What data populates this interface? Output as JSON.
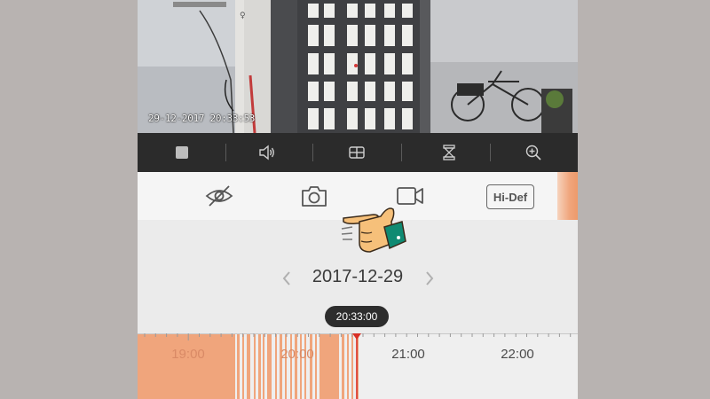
{
  "video": {
    "osd_timestamp": "29-12-2017 20:33:53"
  },
  "controls": {
    "icons": [
      "stop-icon",
      "volume-icon",
      "layout-grid-icon",
      "flip-icon",
      "zoom-in-icon"
    ]
  },
  "actions": {
    "icons": [
      "hide-eye-icon",
      "snapshot-camera-icon",
      "record-video-icon"
    ],
    "hidef_label": "Hi-Def"
  },
  "date_nav": {
    "date": "2017-12-29"
  },
  "timeline": {
    "current_time": "20:33:00",
    "tick_labels": [
      "19:00",
      "20:00",
      "21:00",
      "22:00"
    ],
    "recording_color": "#f0a57c",
    "cursor_color": "#d93025"
  },
  "colors": {
    "accent": "#f0a57c",
    "controls_bg": "#2b2b2b",
    "page_bg": "#b8b3b1"
  }
}
